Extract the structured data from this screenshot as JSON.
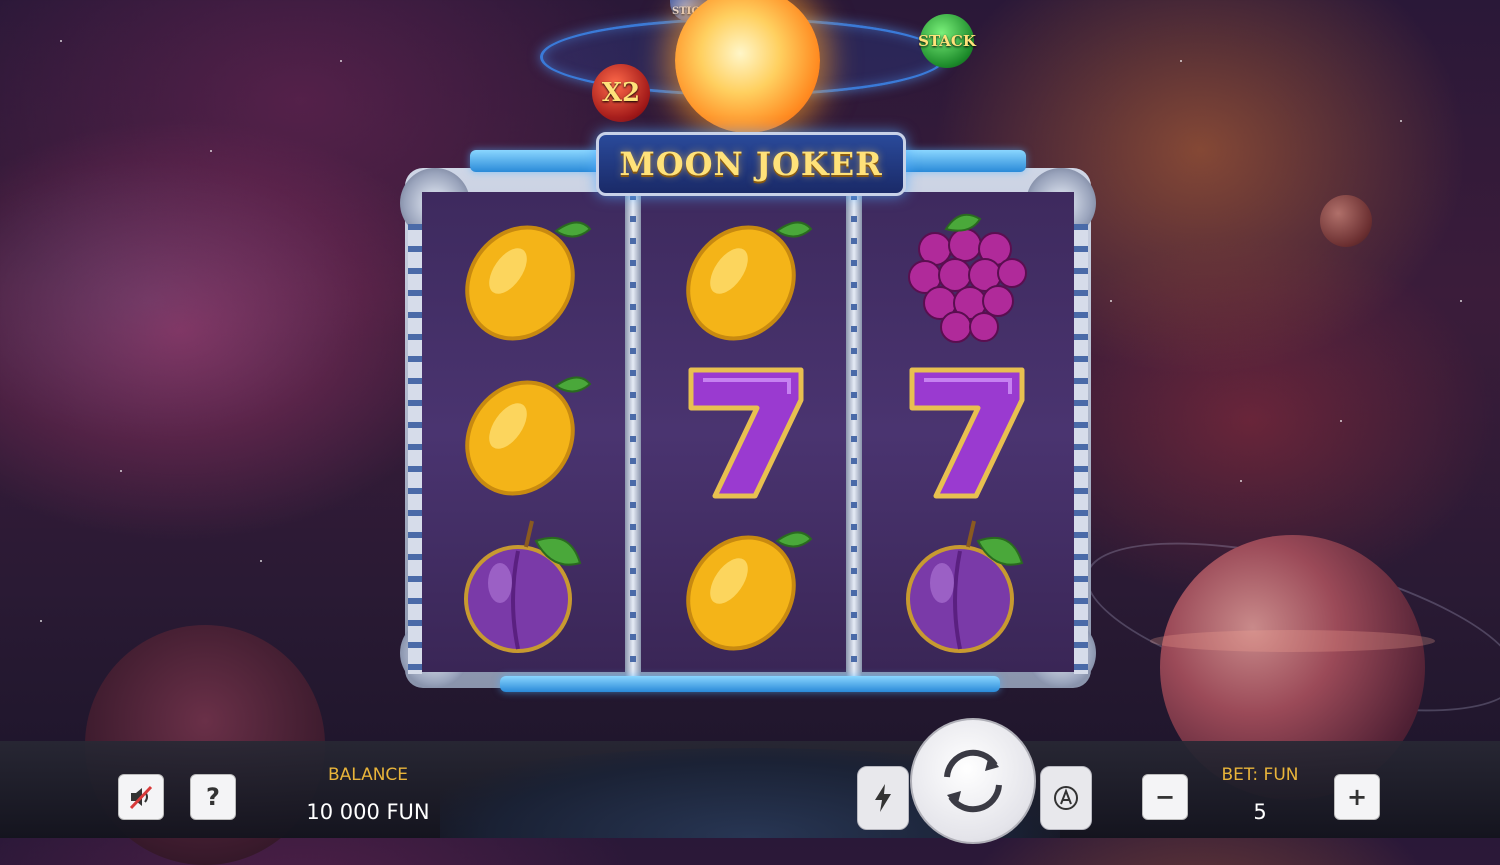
{
  "game": {
    "title": "MOON JOKER"
  },
  "features": {
    "multiplier_label": "X2",
    "stack_label": "STACK",
    "sticky_label": "STICK"
  },
  "reels": [
    [
      "lemon",
      "lemon",
      "plum"
    ],
    [
      "lemon",
      "seven",
      "lemon"
    ],
    [
      "grapes",
      "seven",
      "plum"
    ]
  ],
  "hud": {
    "sound_icon": "sound-muted-icon",
    "help_label": "?",
    "balance_label": "BALANCE",
    "balance_value": "10 000 FUN",
    "turbo_icon": "lightning-icon",
    "spin_icon": "spin-arrows-icon",
    "autoplay_icon": "autoplay-icon",
    "bet_label": "BET: FUN",
    "bet_value": "5",
    "minus_label": "−",
    "plus_label": "+"
  },
  "colors": {
    "label_gold": "#e8b43a",
    "title_gold": "#ffe27a",
    "frame_blue": "#2a8ad8",
    "reel_purple": "#4a3470"
  }
}
